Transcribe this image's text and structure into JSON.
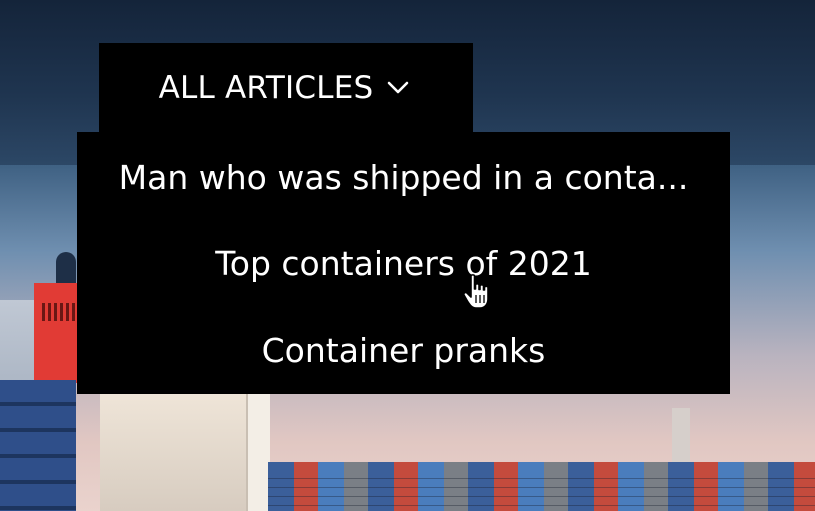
{
  "dropdown": {
    "title": "ALL ARTICLES",
    "toggle_icon": "chevron-down-icon",
    "items": [
      {
        "label": "Man who was shipped in a conta..."
      },
      {
        "label": "Top containers of 2021"
      },
      {
        "label": "Container pranks"
      }
    ],
    "hovered_item": "Top containers of 2021"
  },
  "pointer": {
    "icon": "hand-pointer-icon"
  },
  "colors": {
    "menu_bg": "#000000",
    "menu_text": "#ffffff"
  }
}
